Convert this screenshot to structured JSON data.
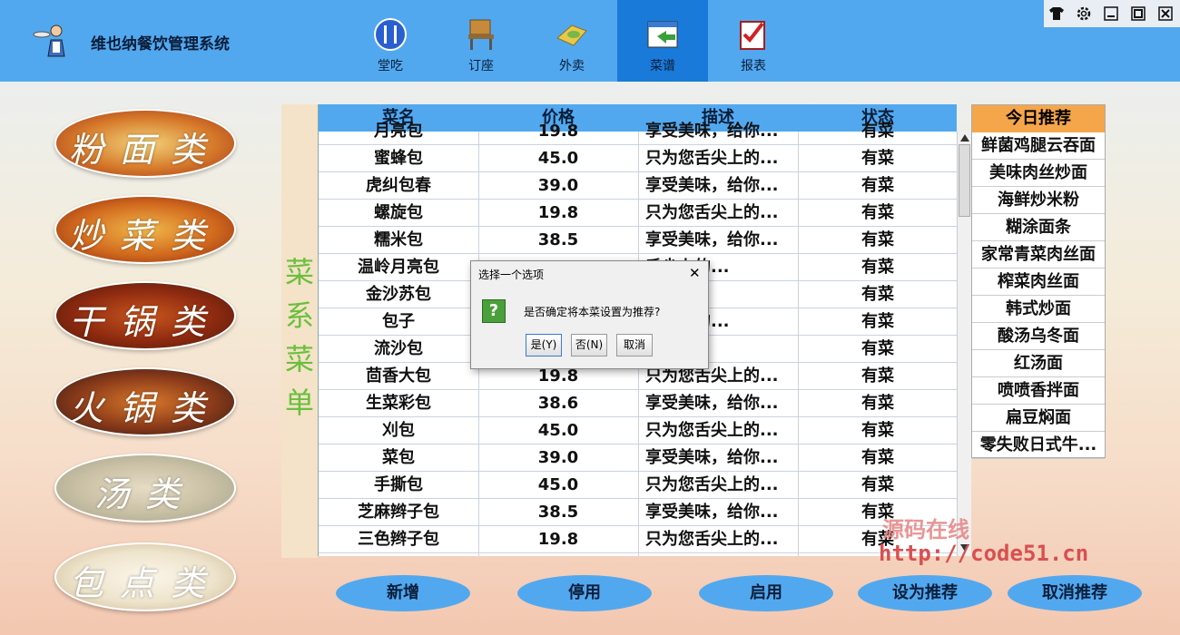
{
  "app": {
    "title": "维也纳餐饮管理系统"
  },
  "nav": [
    {
      "label": "堂吃",
      "icon": "fork-knife-plate-icon"
    },
    {
      "label": "订座",
      "icon": "chair-icon"
    },
    {
      "label": "外卖",
      "icon": "takeout-box-icon"
    },
    {
      "label": "菜谱",
      "icon": "menu-book-icon",
      "active": true
    },
    {
      "label": "报表",
      "icon": "report-checklist-icon"
    }
  ],
  "window_controls": [
    "skin-icon",
    "settings-icon",
    "minimize-icon",
    "maximize-icon",
    "close-icon"
  ],
  "categories": [
    {
      "label": "粉面类"
    },
    {
      "label": "炒菜类"
    },
    {
      "label": "干锅类"
    },
    {
      "label": "火锅类"
    },
    {
      "label": "汤类"
    },
    {
      "label": "包点类"
    }
  ],
  "menu_panel": {
    "chars": [
      "菜",
      "系",
      "菜",
      "单"
    ]
  },
  "table": {
    "headers": [
      "菜名",
      "价格",
      "描述",
      "状态"
    ],
    "rows": [
      [
        "月亮包",
        "19.8",
        "享受美味，给你...",
        "有菜"
      ],
      [
        "蜜蜂包",
        "45.0",
        "只为您舌尖上的...",
        "有菜"
      ],
      [
        "虎纠包春",
        "39.0",
        "享受美味，给你...",
        "有菜"
      ],
      [
        "螺旋包",
        "19.8",
        "只为您舌尖上的...",
        "有菜"
      ],
      [
        "糯米包",
        "38.5",
        "享受美味，给你...",
        "有菜"
      ],
      [
        "温岭月亮包",
        "",
        "舌尖上的...",
        "有菜"
      ],
      [
        "金沙苏包",
        "",
        "给你...",
        "有菜"
      ],
      [
        "包子",
        "",
        "舌尖上的...",
        "有菜"
      ],
      [
        "流沙包",
        "",
        "给你...",
        "有菜"
      ],
      [
        "茴香大包",
        "19.8",
        "只为您舌尖上的...",
        "有菜"
      ],
      [
        "生菜彩包",
        "38.6",
        "享受美味，给你...",
        "有菜"
      ],
      [
        "刈包",
        "45.0",
        "只为您舌尖上的...",
        "有菜"
      ],
      [
        "菜包",
        "39.0",
        "享受美味，给你...",
        "有菜"
      ],
      [
        "手撕包",
        "45.0",
        "只为您舌尖上的...",
        "有菜"
      ],
      [
        "芝麻辫子包",
        "38.5",
        "享受美味，给你...",
        "有菜"
      ],
      [
        "三色辫子包",
        "19.8",
        "只为您舌尖上的...",
        "有菜"
      ]
    ]
  },
  "recommend": {
    "title": "今日推荐",
    "items": [
      "鲜菌鸡腿云吞面",
      "美味肉丝炒面",
      "海鲜炒米粉",
      "糊涂面条",
      "家常青菜肉丝面",
      "榨菜肉丝面",
      "韩式炒面",
      "酸汤乌冬面",
      "红汤面",
      "喷喷香拌面",
      "扁豆焖面",
      "零失败日式牛..."
    ]
  },
  "buttons": {
    "add": "新增",
    "disable": "停用",
    "enable": "启用",
    "set_recommend": "设为推荐",
    "cancel_recommend": "取消推荐"
  },
  "dialog": {
    "title": "选择一个选项",
    "message": "是否确定将本菜设置为推荐?",
    "icon_char": "?",
    "yes": "是(Y)",
    "no": "否(N)",
    "cancel": "取消",
    "close": "✕"
  },
  "watermark": {
    "line1": "源码在线",
    "line2": "http://code51.cn"
  },
  "colors": {
    "header": "#52a8ef",
    "nav_active": "#1a7ad9",
    "recommend_head": "#f5a64a",
    "vertical_text": "#6abf3c"
  }
}
